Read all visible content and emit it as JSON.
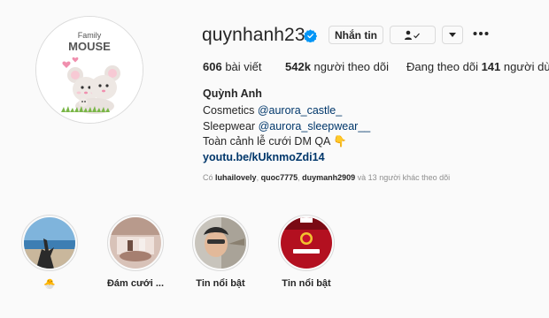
{
  "profile": {
    "username": "quynhanh23",
    "avatar_text_top": "Family",
    "avatar_text_main": "MOUSE",
    "buttons": {
      "message": "Nhắn tin",
      "follow_icon": "person-check-icon",
      "dropdown_icon": "chevron-down-icon",
      "more_icon": "more-dots-icon"
    }
  },
  "stats": {
    "posts_count": "606",
    "posts_label": "bài viết",
    "followers_count": "542k",
    "followers_label": "người theo dõi",
    "following_prefix": "Đang theo dõi",
    "following_count": "141",
    "following_label": "người dùng"
  },
  "bio": {
    "name": "Quỳnh Anh",
    "line1_text": "Cosmetics",
    "line1_mention": "@aurora_castle_",
    "line2_text": "Sleepwear",
    "line2_mention": "@aurora_sleepwear__",
    "line3_text": "Toàn cảnh lễ cưới DM QA",
    "line3_emoji": "👇",
    "link": "youtu.be/kUknmoZdi14"
  },
  "followed_by": {
    "prefix": "Có",
    "user1": "luhailovely",
    "user2": "quoc7775",
    "user3": "duymanh2909",
    "suffix": "và 13 người khác theo dõi"
  },
  "highlights": [
    {
      "label": "🐣"
    },
    {
      "label": "Đám cưới ..."
    },
    {
      "label": "Tin nổi bật"
    },
    {
      "label": "Tin nổi bật"
    }
  ],
  "colors": {
    "background": "#fafafa",
    "text": "#262626",
    "link": "#00376b",
    "muted": "#8e8e8e",
    "verified": "#0095f6",
    "border": "#dbdbdb"
  }
}
